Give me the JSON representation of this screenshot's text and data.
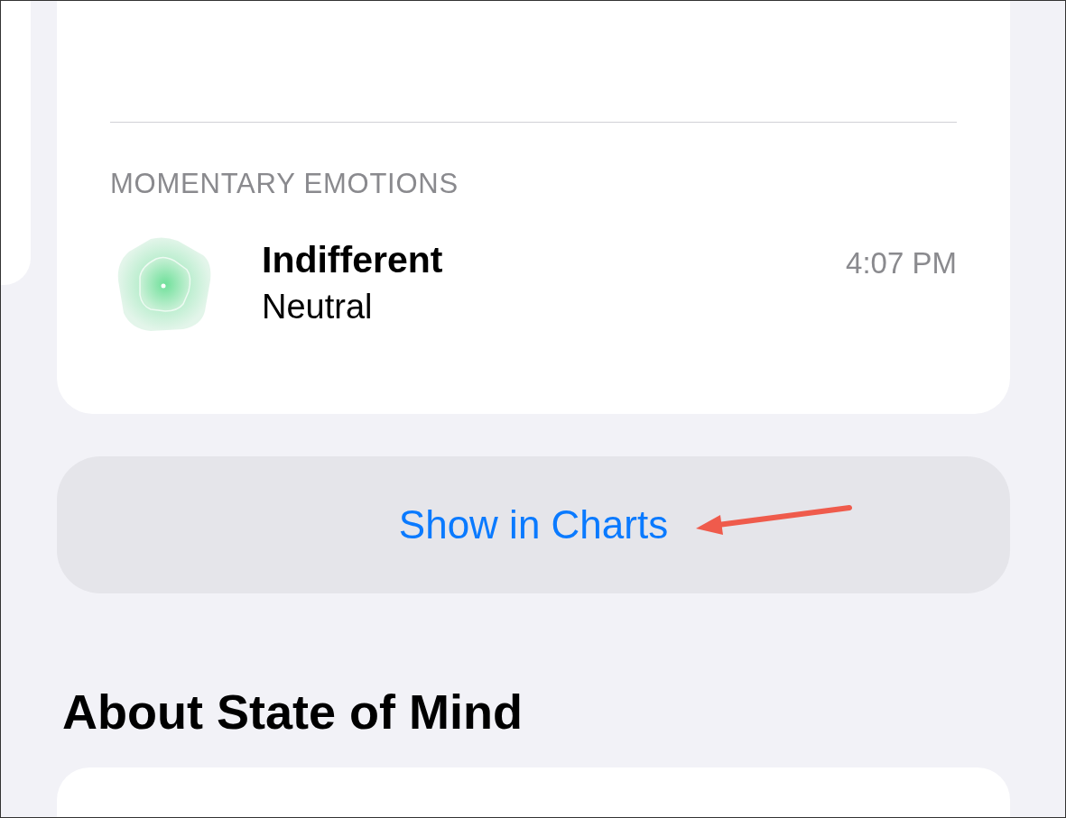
{
  "momentary_emotions": {
    "heading": "MOMENTARY EMOTIONS",
    "entries": [
      {
        "emotion": "Indifferent",
        "valence": "Neutral",
        "time": "4:07 PM"
      }
    ]
  },
  "show_in_charts_button": "Show in Charts",
  "about_section": {
    "title": "About State of Mind"
  }
}
